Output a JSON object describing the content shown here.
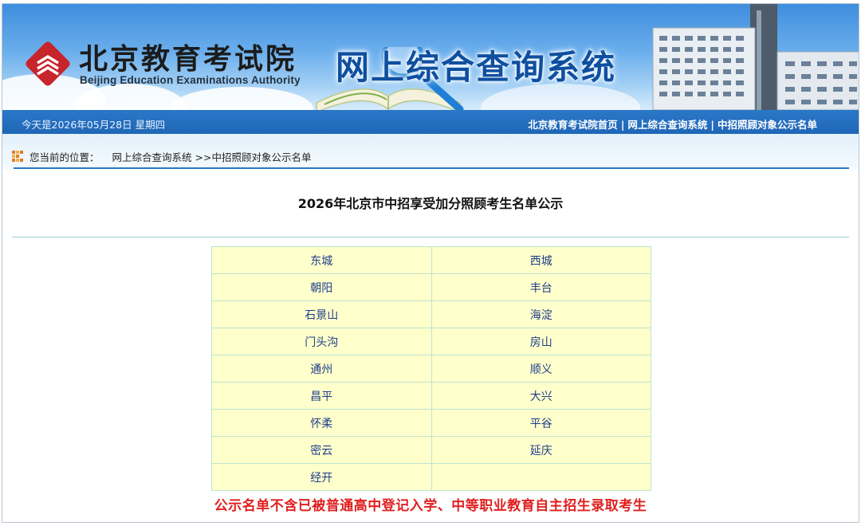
{
  "header": {
    "org_name_cn": "北京教育考试院",
    "org_name_en": "Beijing Education Examinations Authority",
    "system_title": "网上综合查询系统"
  },
  "topbar": {
    "date_text": "今天是2026年05月28日  星期四",
    "nav": [
      {
        "label": "北京教育考试院首页"
      },
      {
        "label": "网上综合查询系统"
      },
      {
        "label": "中招照顾对象公示名单"
      }
    ],
    "separator": "|"
  },
  "breadcrumb": {
    "prefix": "您当前的位置：",
    "home": "网上综合查询系统",
    "current": ">>中招照顾对象公示名单"
  },
  "main": {
    "title": "2026年北京市中招享受加分照顾考生名单公示",
    "districts": [
      [
        "东城",
        "西城"
      ],
      [
        "朝阳",
        "丰台"
      ],
      [
        "石景山",
        "海淀"
      ],
      [
        "门头沟",
        "房山"
      ],
      [
        "通州",
        "顺义"
      ],
      [
        "昌平",
        "大兴"
      ],
      [
        "怀柔",
        "平谷"
      ],
      [
        "密云",
        "延庆"
      ],
      [
        "经开",
        ""
      ]
    ],
    "notice": "公示名单不含已被普通高中登记入学、中等职业教育自主招生录取考生"
  },
  "colors": {
    "banner_blue": "#3f8dde",
    "bar_blue": "#1f66b6",
    "table_bg": "#ffffcc",
    "link_blue": "#1e3d8a",
    "notice_red": "#e02020",
    "logo_red": "#c8242b"
  },
  "icons": [
    "logo-emblem-icon",
    "breadcrumb-grid-icon"
  ]
}
